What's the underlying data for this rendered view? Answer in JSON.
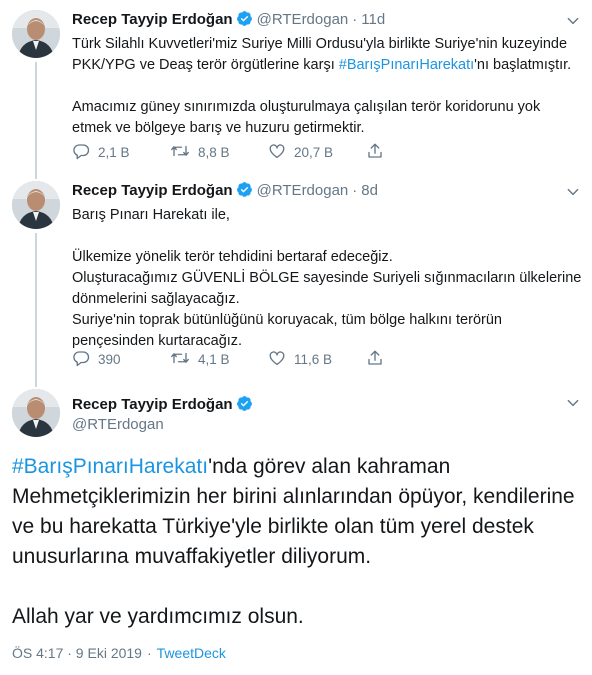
{
  "author": {
    "name": "Recep Tayyip Erdoğan",
    "handle": "@RTErdogan"
  },
  "thread": [
    {
      "time": "11d",
      "paragraphs": [
        [
          {
            "t": "Türk Silahlı Kuvvetleri'miz Suriye Milli Ordusu'yla birlikte Suriye'nin kuzeyinde PKK/YPG ve Deaş terör örgütlerine karşı "
          },
          {
            "t": "#BarışPınarıHarekatı",
            "link": true
          },
          {
            "t": "'nı başlatmıştır."
          }
        ],
        [
          {
            "t": "Amacımız güney sınırımızda oluşturulmaya çalışılan terör koridorunu yok etmek ve bölgeye barış ve huzuru getirmektir."
          }
        ]
      ],
      "stats": {
        "replies": "2,1 B",
        "retweets": "8,8 B",
        "likes": "20,7 B"
      }
    },
    {
      "time": "8d",
      "paragraphs": [
        [
          {
            "t": "Barış Pınarı Harekatı ile,"
          }
        ],
        [
          {
            "t": "Ülkemize yönelik terör tehdidini bertaraf edeceğiz."
          }
        ],
        [
          {
            "t": "Oluşturacağımız GÜVENLİ BÖLGE sayesinde Suriyeli sığınmacıların ülkelerine dönmelerini sağlayacağız."
          }
        ],
        [
          {
            "t": "Suriye'nin toprak bütünlüğünü koruyacak, tüm bölge halkını terörün pençesinden kurtaracağız."
          }
        ]
      ],
      "stats": {
        "replies": "390",
        "retweets": "4,1 B",
        "likes": "11,6 B"
      }
    }
  ],
  "main_tweet": {
    "paragraphs": [
      [
        {
          "t": "#BarışPınarıHarekatı",
          "link": true
        },
        {
          "t": "'nda görev alan kahraman Mehmetçiklerimizin her birini alınlarından öpüyor, kendilerine ve bu harekatta Türkiye'yle birlikte olan tüm yerel destek unusurlarına muvaffakiyetler diliyorum."
        }
      ],
      [
        {
          "t": "Allah yar ve yardımcımız olsun."
        }
      ]
    ],
    "timestamp": "ÖS 4:17 · 9 Eki 2019",
    "source": "TweetDeck",
    "separator": "·"
  },
  "colors": {
    "link": "#1b95e0",
    "secondary": "#657786",
    "verified": "#1da1f2"
  },
  "icons": {
    "reply": "reply-icon",
    "retweet": "retweet-icon",
    "like": "like-icon",
    "share": "share-icon",
    "verified": "verified-badge-icon",
    "menu": "chevron-down-icon"
  }
}
